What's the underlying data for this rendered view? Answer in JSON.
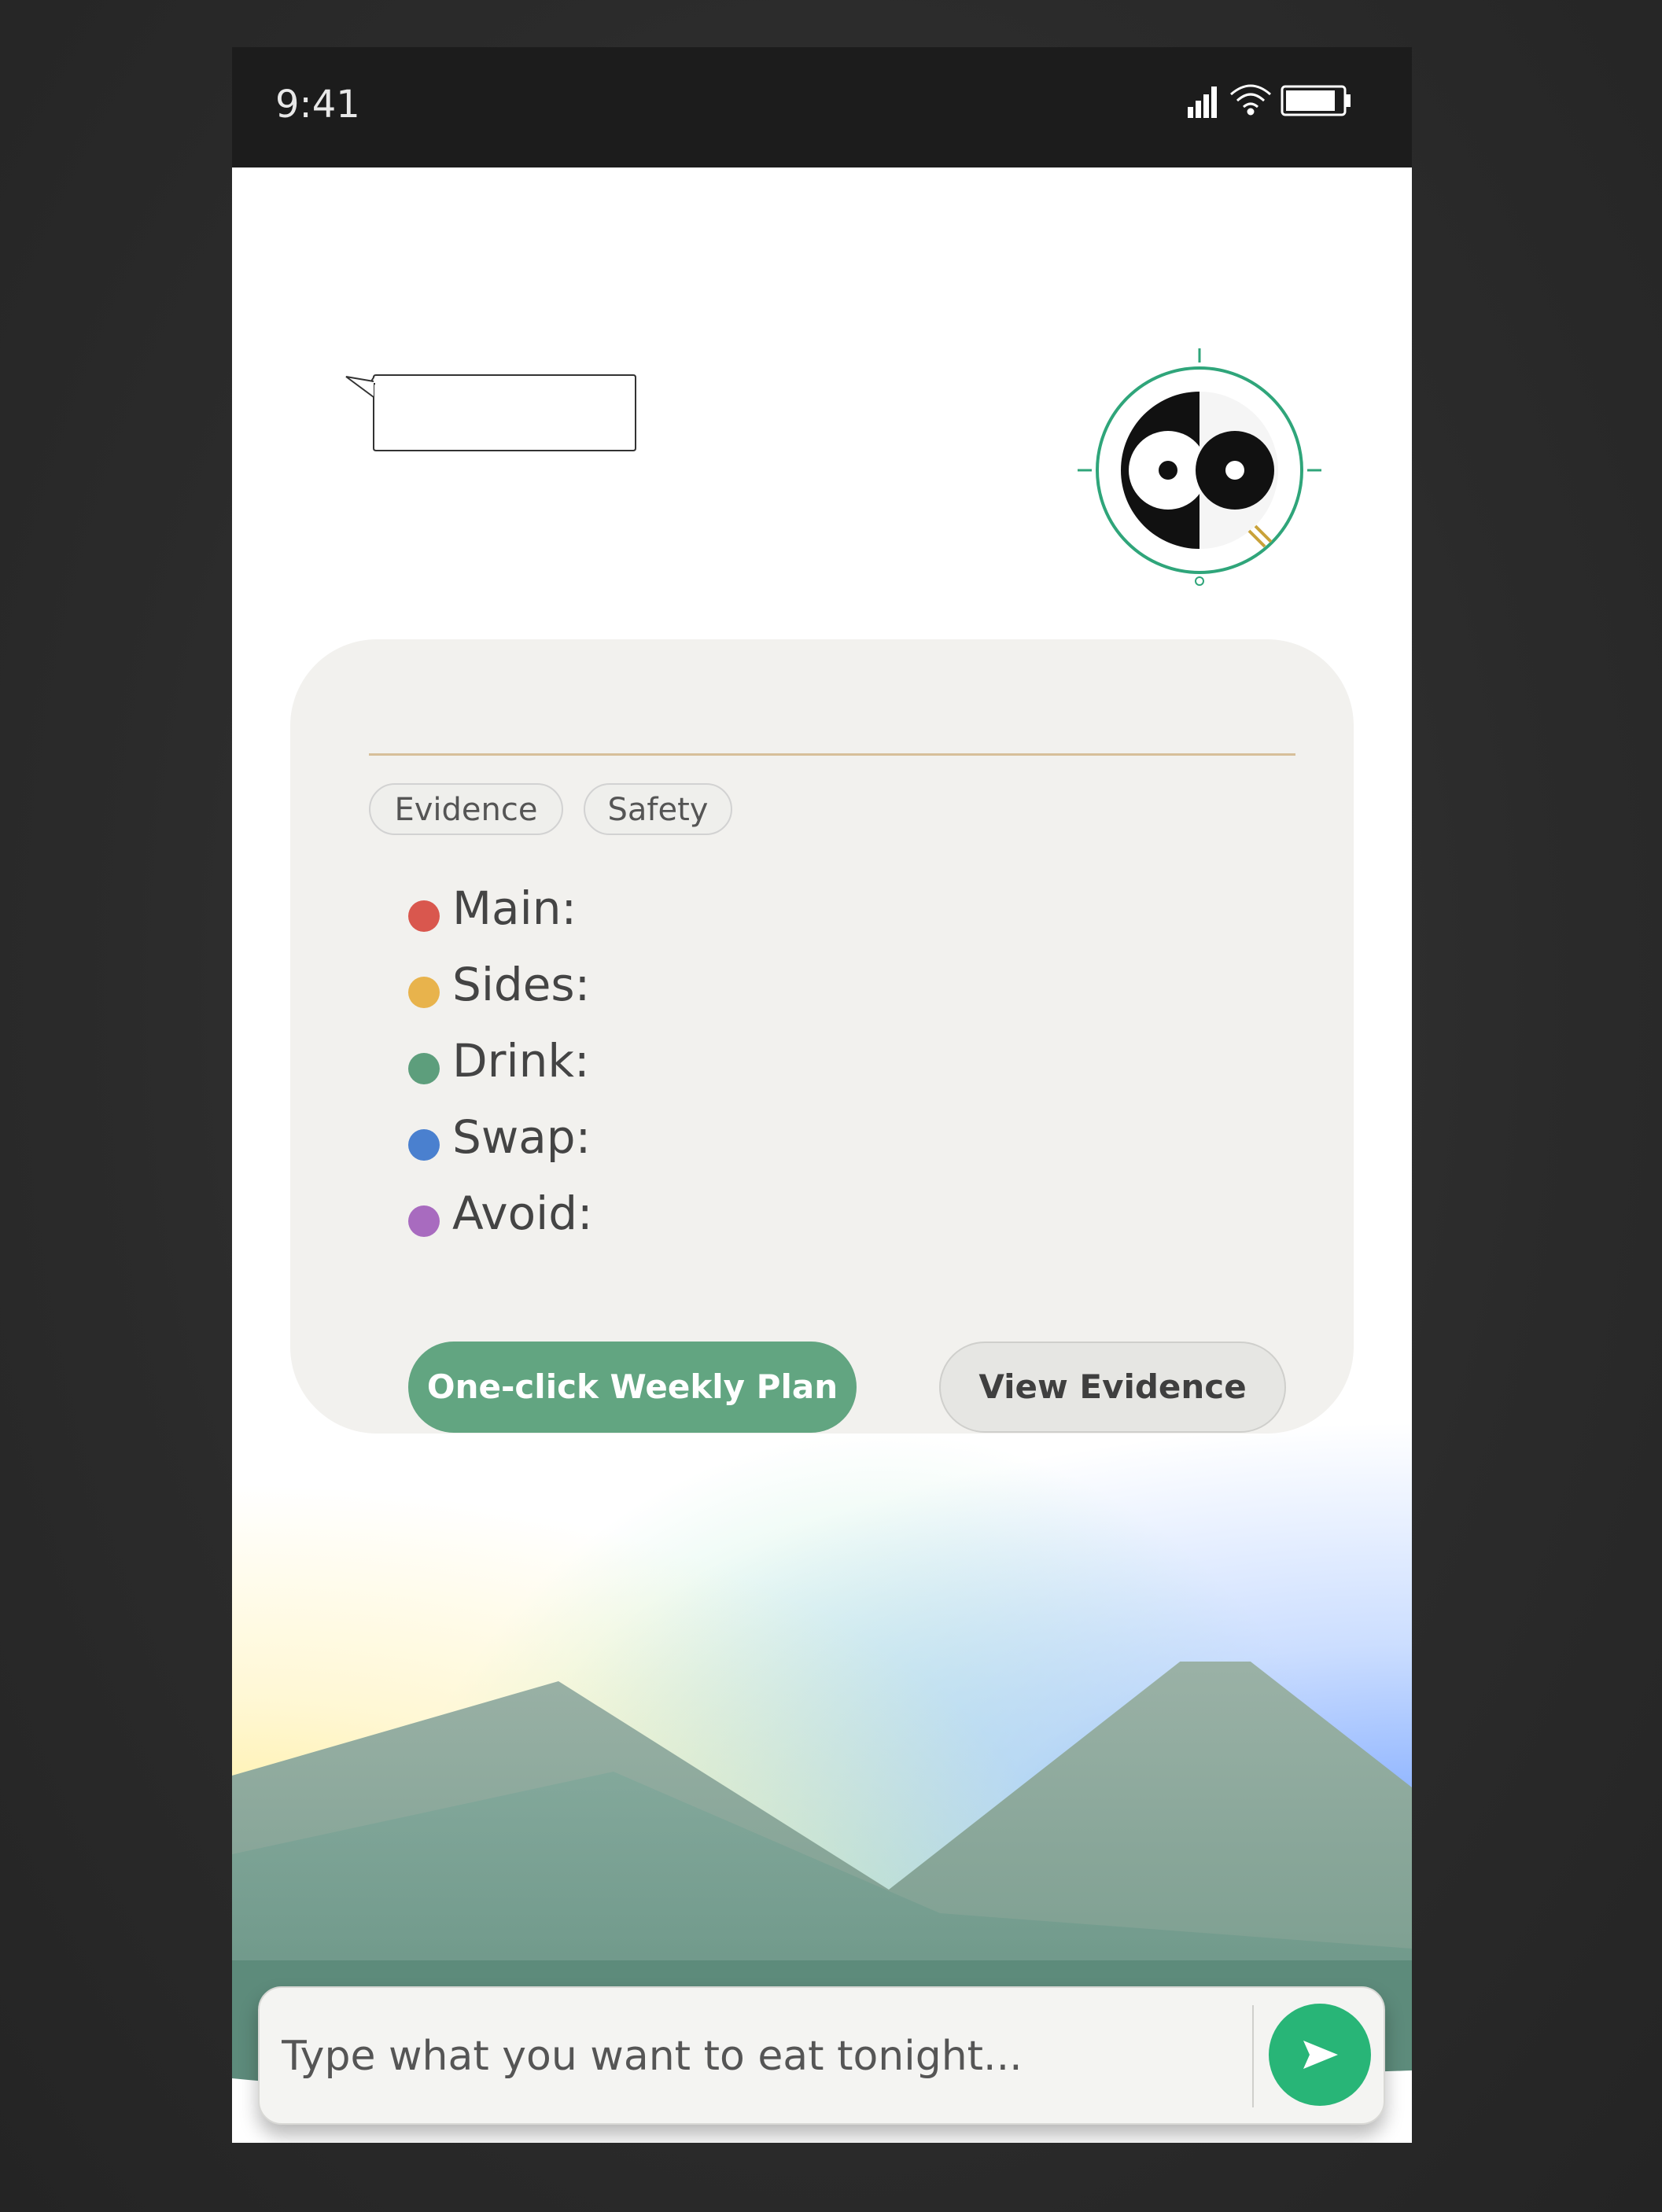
{
  "status_bar": {
    "time": "9:41"
  },
  "card": {
    "chips": [
      "Evidence",
      "Safety"
    ],
    "plan_items": [
      {
        "label": "Main:",
        "color": "#d9574e"
      },
      {
        "label": "Sides:",
        "color": "#e8b34c"
      },
      {
        "label": "Drink:",
        "color": "#5d9e7c"
      },
      {
        "label": "Swap:",
        "color": "#4a80cf"
      },
      {
        "label": "Avoid:",
        "color": "#a86bbf"
      }
    ],
    "primary_button_label": "One-click Weekly Plan",
    "secondary_button_label": "View Evidence"
  },
  "composer": {
    "placeholder": "Type what you want to eat tonight..."
  },
  "icons": {
    "signal": "signal-icon",
    "wifi": "wifi-icon",
    "battery": "battery-icon",
    "speech_bubble": "speech-bubble-icon",
    "logo": "mascot-logo-icon",
    "send": "send-arrow-icon"
  },
  "colors": {
    "accent_green": "#28b577",
    "primary_button": "#62a581",
    "divider": "#d7bf99",
    "card_background": "#f2f1ee"
  }
}
